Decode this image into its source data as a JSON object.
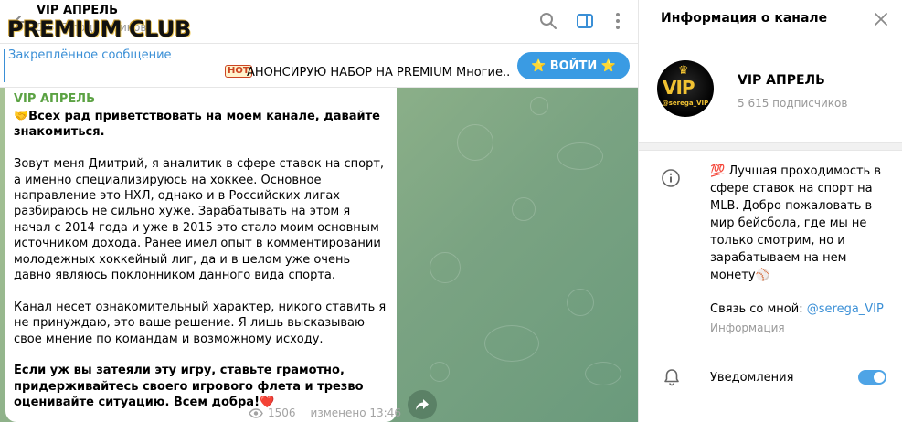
{
  "header": {
    "channel_title": "VIP АПРЕЛЬ",
    "subscribers": "5 615 подписчиков"
  },
  "pinned": {
    "label": "Закреплённое сообщение",
    "logo_text": "PREMIUM CLUB",
    "hot_badge": "HOT",
    "preview": "АНОНСИРУЮ НАБОР НА PREMIUM   Многие...",
    "join_button": "⭐ ВОЙТИ ⭐"
  },
  "message": {
    "author": "VIP АПРЕЛЬ",
    "paragraphs": [
      "🤝Всех рад приветствовать на моем канале, давайте знакомиться.",
      "Зовут меня Дмитрий, я аналитик в сфере ставок на спорт, а именно специализируюсь на хоккее. Основное направление это НХЛ, однако и в Российских лигах разбираюсь не сильно хуже. Зарабатывать на этом я начал с 2014 года и уже в 2015 это стало моим основным источником дохода. Ранее имел опыт в комментировании молодежных хоккейный лиг, да и в целом уже очень давно являюсь поклонником данного вида спорта.",
      "Канал несет ознакомительный характер, никого ставить я не принуждаю, это ваше решение. Я лишь высказываю свое мнение по командам и возможному исходу.",
      "Если уж вы затеяли эту игру, ставьте грамотно, придерживайтесь своего игрового флета и трезво оценивайте ситуацию. Всем добра!❤️"
    ],
    "views": "1506",
    "edited": "изменено 13:46"
  },
  "info_panel": {
    "heading": "Информация о канале",
    "title": "VIP АПРЕЛЬ",
    "subscribers": "5 615 подписчиков",
    "avatar_text": "VIP",
    "avatar_handle": "@serega_VIP",
    "description": "💯 Лучшая проходимость в сфере ставок на спорт на MLB. Добро пожаловать в мир бейсбола, где мы не только смотрим, но и зарабатываем на нем монету⚾",
    "contact_prefix": "Связь со мной: ",
    "contact_link": "@serega_VIP",
    "contact_label": "Информация",
    "notifications_label": "Уведомления",
    "notifications_on": true
  },
  "colors": {
    "accent": "#3a9be3",
    "author_green": "#5ba243",
    "chat_bg": "#8fb28a"
  },
  "icons": [
    "back-arrow-icon",
    "search-icon",
    "sidebar-toggle-icon",
    "more-vertical-icon",
    "close-icon",
    "info-icon",
    "bell-icon",
    "eye-icon",
    "share-icon"
  ]
}
